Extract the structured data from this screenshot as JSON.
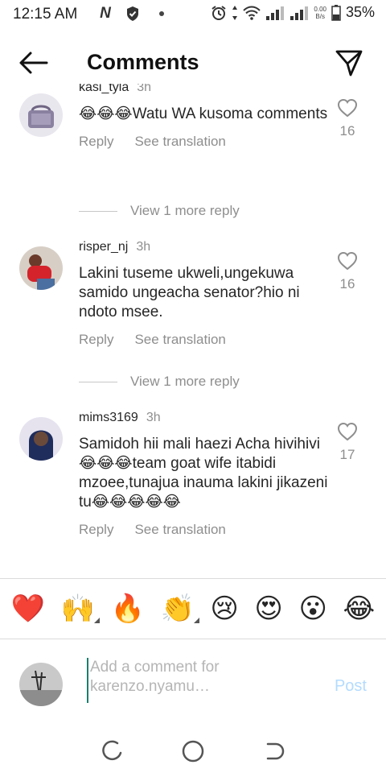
{
  "status_bar": {
    "time": "12:15 AM",
    "net_speed_value": "0.00",
    "net_speed_unit": "B/s",
    "battery": "35%"
  },
  "header": {
    "title": "Comments"
  },
  "comments": [
    {
      "username": "kasi_tyla",
      "time": "3h",
      "text": "😂😂😂Watu WA kusoma comments",
      "reply_label": "Reply",
      "translate_label": "See translation",
      "likes": "16",
      "view_more": "View 1 more reply"
    },
    {
      "username": "risper_nj",
      "time": "3h",
      "text": "Lakini tuseme ukweli,ungekuwa samido ungeacha senator?hio ni ndoto msee.",
      "reply_label": "Reply",
      "translate_label": "See translation",
      "likes": "16",
      "view_more": "View 1 more reply"
    },
    {
      "username": "mims3169",
      "time": "3h",
      "text": "Samidoh hii mali haezi Acha hivihivi😂😂😂team goat wife itabidi mzoee,tunajua inauma lakini jikazeni tu😂😂😂😂😂",
      "reply_label": "Reply",
      "translate_label": "See translation",
      "likes": "17"
    }
  ],
  "emoji_bar": [
    "❤️",
    "🙌",
    "🔥",
    "👏",
    "😢",
    "😍",
    "😮",
    "😂"
  ],
  "compose": {
    "placeholder": "Add a comment for karenzo.nyamu…",
    "post_label": "Post"
  },
  "colors": {
    "accent_disabled": "#b3dbff",
    "muted_text": "#8e8e8e"
  }
}
